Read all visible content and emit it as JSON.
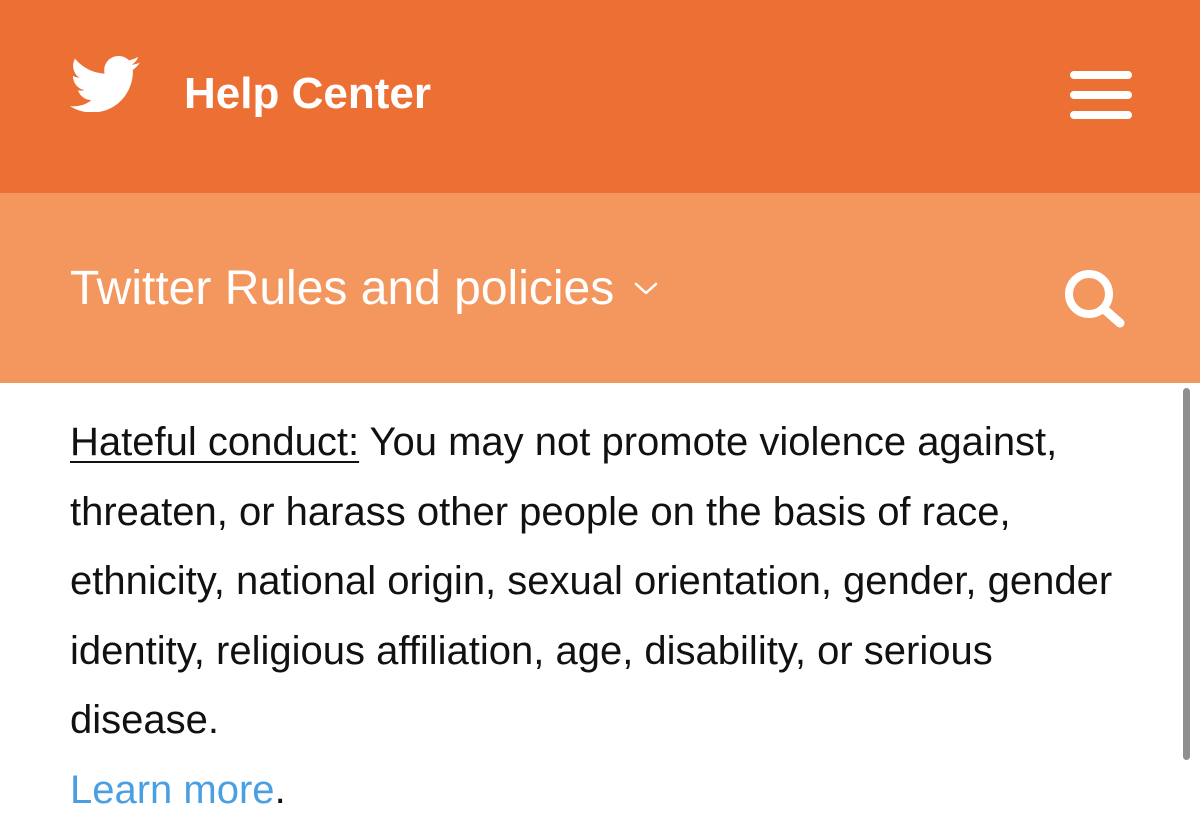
{
  "header": {
    "title": "Help Center",
    "logo_icon": "twitter-bird-icon",
    "menu_icon": "hamburger-menu-icon",
    "background_color": "#ec7034"
  },
  "subheader": {
    "section_label": "Twitter Rules and policies",
    "dropdown_icon": "chevron-down-icon",
    "search_icon": "search-icon",
    "background_color": "#f4975f"
  },
  "content": {
    "term": "Hateful conduct:",
    "text": " You may not promote violence against, threaten, or harass other people on the basis of race, ethnicity, national origin, sexual orientation, gender, gender identity, religious affiliation, age, disability, or serious disease.",
    "link_label": "Learn more",
    "link_suffix": ".",
    "link_color": "#4a9fe3"
  }
}
